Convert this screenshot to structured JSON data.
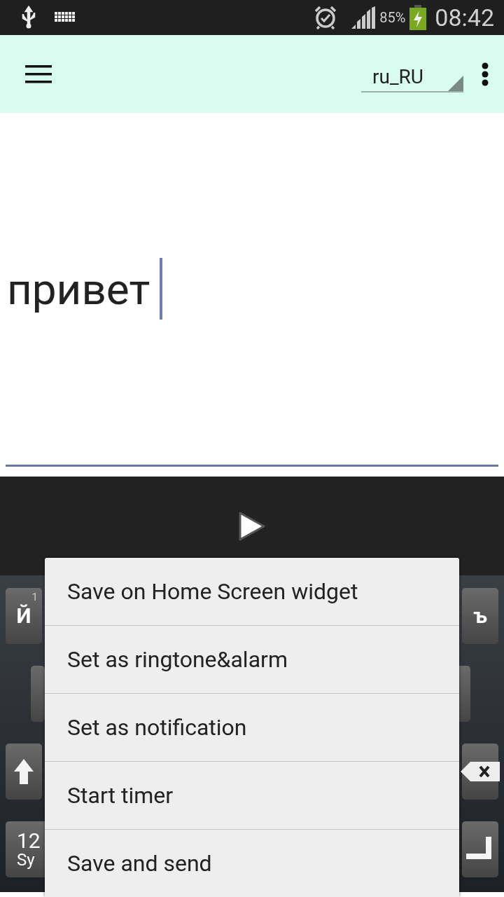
{
  "status_bar": {
    "battery_text": "85%",
    "time": "08:42"
  },
  "app_bar": {
    "locale": "ru_RU"
  },
  "editor": {
    "text": "привет"
  },
  "keyboard": {
    "rows": [
      {
        "left": {
          "kind": "letter",
          "label": "Й",
          "hint": "1"
        },
        "right": {
          "kind": "letter",
          "label": "ъ"
        }
      },
      {
        "left": {
          "kind": "blank"
        },
        "right": {
          "kind": "blank"
        }
      },
      {
        "left": {
          "kind": "shift"
        },
        "right": {
          "kind": "backspace"
        }
      },
      {
        "left": {
          "kind": "symbols",
          "label": "12",
          "sublabel": "Sy"
        },
        "right": {
          "kind": "enter"
        }
      }
    ]
  },
  "menu": {
    "items": [
      {
        "label": "Save on Home Screen widget"
      },
      {
        "label": "Set as ringtone&alarm"
      },
      {
        "label": "Set as notification"
      },
      {
        "label": "Start timer"
      },
      {
        "label": "Save and send"
      }
    ]
  }
}
